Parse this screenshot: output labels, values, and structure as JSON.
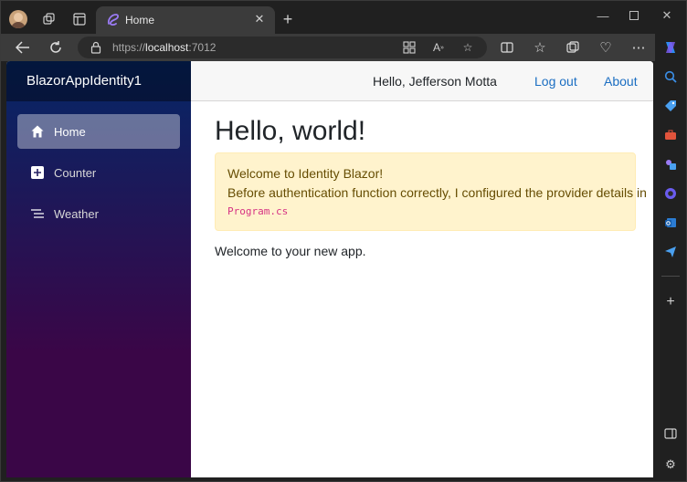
{
  "browser": {
    "tab": {
      "title": "Home"
    },
    "address": {
      "scheme": "https://",
      "host": "localhost",
      "port": ":7012"
    }
  },
  "app": {
    "brand": "BlazorAppIdentity1",
    "nav": [
      {
        "label": "Home",
        "active": true
      },
      {
        "label": "Counter",
        "active": false
      },
      {
        "label": "Weather",
        "active": false
      }
    ],
    "top_row": {
      "greeting": "Hello, Jefferson Motta",
      "logout": "Log out",
      "about": "About"
    },
    "main": {
      "heading": "Hello, world!",
      "alert": {
        "line1": "Welcome to Identity Blazor!",
        "line2": "Before authentication function correctly, I configured the provider details in",
        "code": "Program.cs"
      },
      "welcome": "Welcome to your new app."
    }
  },
  "colors": {
    "nav_top": "#052767",
    "nav_bottom": "#3a0647",
    "link": "#1b6ec2",
    "alert_bg": "#fff3cd",
    "alert_text": "#664d03",
    "code": "#d63384"
  }
}
